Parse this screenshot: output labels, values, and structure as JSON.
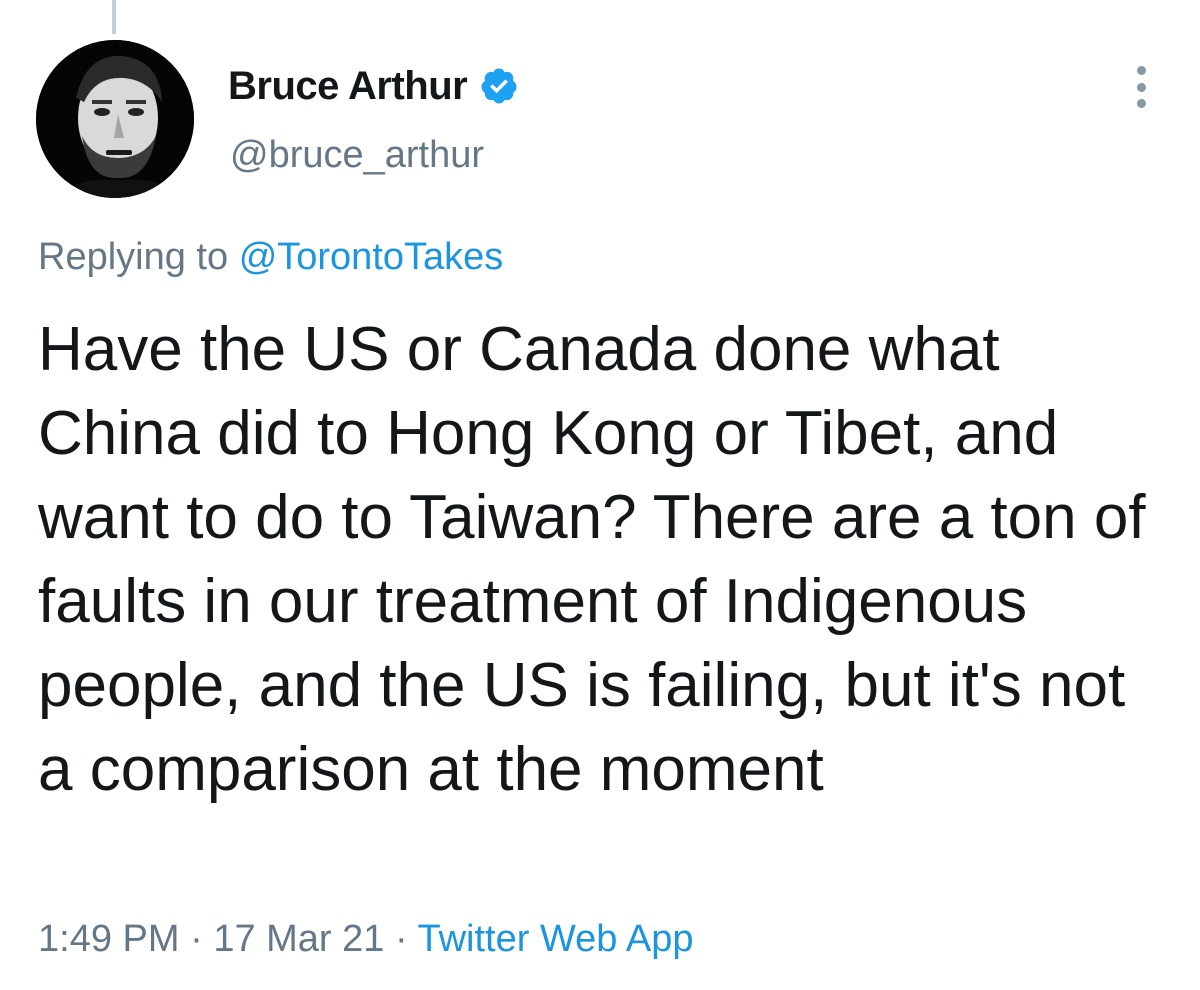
{
  "author": {
    "display_name": "Bruce Arthur",
    "handle": "@bruce_arthur",
    "verified_icon": "verified-badge-icon",
    "avatar_icon": "profile-photo"
  },
  "reply": {
    "prefix": "Replying to",
    "mention": "@TorontoTakes"
  },
  "tweet": {
    "text": "Have the US or Canada done what China did to Hong Kong or Tibet, and want to do to Taiwan? There are a ton of faults in our treatment of Indigenous people, and the US is failing, but it's not a comparison at the moment"
  },
  "meta": {
    "time": "1:49 PM",
    "separator": "·",
    "date": "17 Mar 21",
    "source": "Twitter Web App"
  },
  "colors": {
    "link": "#1b95e0",
    "secondary_text": "#657786",
    "primary_text": "#14171a",
    "verified": "#1da1f2"
  }
}
